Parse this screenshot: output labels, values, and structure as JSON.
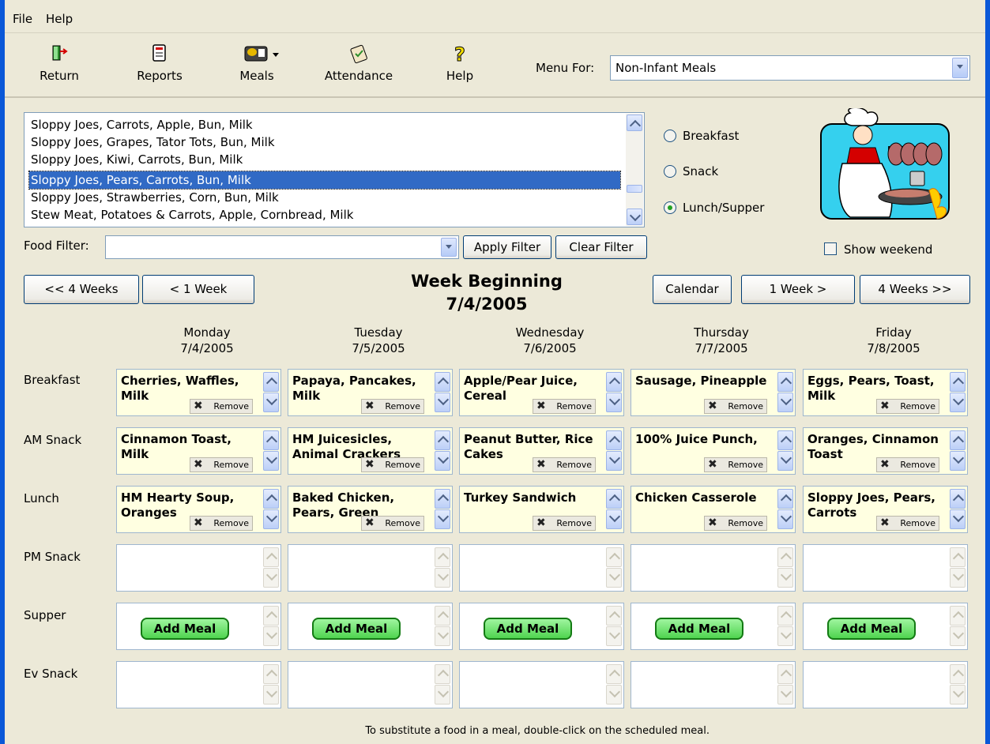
{
  "menu": [
    "File",
    "Help"
  ],
  "toolbar": {
    "buttons": [
      {
        "label": "Return",
        "icon": "exit-door-icon"
      },
      {
        "label": "Reports",
        "icon": "report-icon"
      },
      {
        "label": "Meals",
        "icon": "meal-icon"
      },
      {
        "label": "Attendance",
        "icon": "clipboard-icon"
      },
      {
        "label": "Help",
        "icon": "question-icon"
      }
    ],
    "menu_for_label": "Menu For:",
    "menu_for_value": "Non-Infant Meals"
  },
  "meal_list": [
    "Sloppy Joes, Carrots, Apple, Bun, Milk",
    "Sloppy Joes, Grapes, Tator Tots, Bun, Milk",
    "Sloppy Joes, Kiwi, Carrots, Bun, Milk",
    "Sloppy Joes, Pears, Carrots, Bun, Milk",
    "Sloppy Joes, Strawberries, Corn, Bun, Milk",
    "Stew Meat, Potatoes & Carrots, Apple, Cornbread, Milk"
  ],
  "meal_type": {
    "options": [
      "Breakfast",
      "Snack",
      "Lunch/Supper"
    ],
    "selected": "Lunch/Supper"
  },
  "filter": {
    "label": "Food Filter:",
    "value": "",
    "apply": "Apply Filter",
    "clear": "Clear Filter"
  },
  "show_weekend": "Show weekend",
  "nav": {
    "back4": "<< 4 Weeks",
    "back1": "< 1 Week",
    "calendar": "Calendar",
    "fwd1": "1 Week >",
    "fwd4": "4 Weeks >>"
  },
  "week": {
    "title": "Week Beginning",
    "date": "7/4/2005"
  },
  "days": [
    {
      "name": "Monday",
      "date": "7/4/2005"
    },
    {
      "name": "Tuesday",
      "date": "7/5/2005"
    },
    {
      "name": "Wednesday",
      "date": "7/6/2005"
    },
    {
      "name": "Thursday",
      "date": "7/7/2005"
    },
    {
      "name": "Friday",
      "date": "7/8/2005"
    }
  ],
  "rows": [
    "Breakfast",
    "AM Snack",
    "Lunch",
    "PM Snack",
    "Supper",
    "Ev Snack"
  ],
  "meals": {
    "Breakfast": [
      "Cherries, Waffles, Milk",
      "Papaya, Pancakes, Milk",
      "Apple/Pear Juice, Cereal",
      "Sausage, Pineapple",
      "Eggs, Pears, Toast, Milk"
    ],
    "AM Snack": [
      "Cinnamon Toast, Milk",
      "HM Juicesicles, Animal Crackers",
      "Peanut Butter, Rice Cakes",
      "100% Juice Punch,",
      "Oranges, Cinnamon Toast"
    ],
    "Lunch": [
      "HM Hearty Soup, Oranges",
      "Baked Chicken, Pears, Green",
      "Turkey Sandwich",
      "Chicken Casserole",
      "Sloppy Joes, Pears, Carrots"
    ]
  },
  "remove_label": "Remove",
  "add_meal_label": "Add Meal",
  "footer": "To substitute a food in a meal, double-click on the scheduled meal."
}
